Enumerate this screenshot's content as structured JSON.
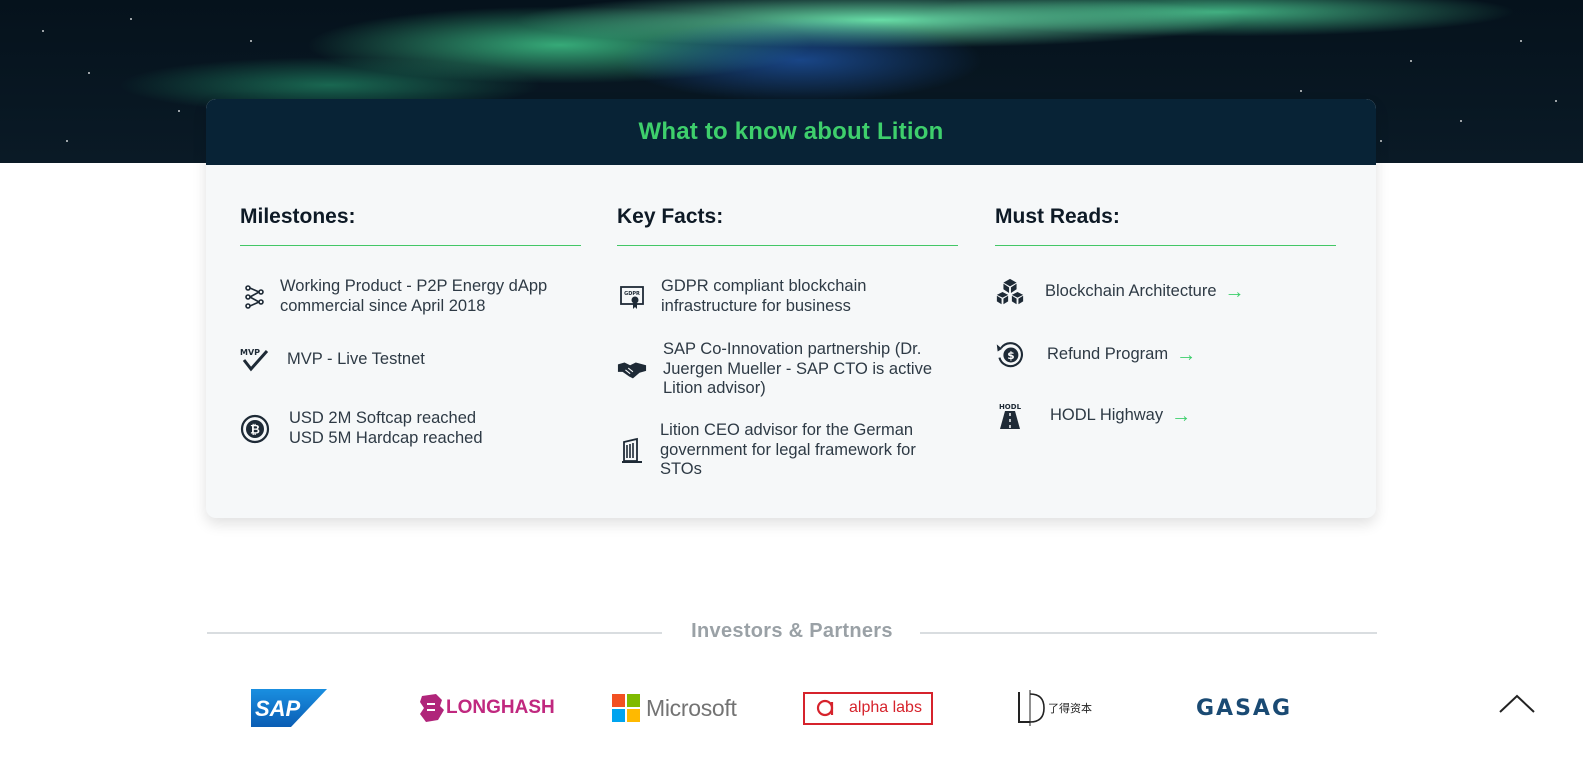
{
  "card": {
    "title": "What to know about Lition"
  },
  "milestones": {
    "heading": "Milestones:",
    "items": [
      {
        "icon": "network-nodes-icon",
        "lines": [
          "Working Product - P2P Energy dApp",
          "commercial since April 2018"
        ]
      },
      {
        "icon": "mvp-check-icon",
        "lines": [
          "MVP - Live Testnet"
        ]
      },
      {
        "icon": "bitcoin-cycle-icon",
        "lines": [
          "USD 2M Softcap reached",
          "USD 5M Hardcap reached"
        ]
      }
    ]
  },
  "key_facts": {
    "heading": "Key Facts:",
    "items": [
      {
        "icon": "gdpr-certificate-icon",
        "lines": [
          "GDPR compliant blockchain",
          "infrastructure for business"
        ]
      },
      {
        "icon": "handshake-icon",
        "lines": [
          "SAP Co-Innovation partnership (Dr.",
          "Juergen Mueller - SAP CTO is active",
          "Lition advisor)"
        ]
      },
      {
        "icon": "government-building-icon",
        "lines": [
          "Lition CEO advisor for the German",
          "government for legal framework for",
          "STOs"
        ]
      }
    ]
  },
  "must_reads": {
    "heading": "Must Reads:",
    "items": [
      {
        "icon": "blockchain-cubes-icon",
        "label": "Blockchain Architecture",
        "arrow": "→"
      },
      {
        "icon": "refund-dollar-icon",
        "label": "Refund Program",
        "arrow": "→"
      },
      {
        "icon": "hodl-highway-icon",
        "label": "HODL Highway",
        "arrow": "→"
      }
    ]
  },
  "investors": {
    "title": "Investors & Partners",
    "logos": [
      "SAP",
      "LONGHASH",
      "Microsoft",
      "alpha labs",
      "了得资本",
      "GASAG"
    ]
  },
  "colors": {
    "accent_green": "#3ecf6c",
    "header_navy": "#082336",
    "divider_green": "#43c766"
  }
}
